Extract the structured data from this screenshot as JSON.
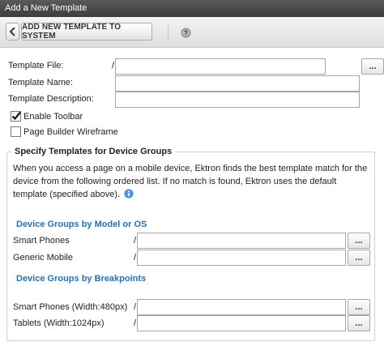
{
  "window": {
    "title": "Add a New Template"
  },
  "toolbar": {
    "add_label": "ADD NEW TEMPLATE TO SYSTEM",
    "back_icon": "back-arrow-icon",
    "help_icon": "help-icon"
  },
  "form": {
    "template_file": {
      "label": "Template File:",
      "prefix": "/",
      "value": "",
      "browse_label": "..."
    },
    "template_name": {
      "label": "Template Name:",
      "value": ""
    },
    "template_description": {
      "label": "Template Description:",
      "value": ""
    },
    "enable_toolbar": {
      "label": "Enable Toolbar",
      "checked": true
    },
    "page_builder_wireframe": {
      "label": "Page Builder Wireframe",
      "checked": false
    }
  },
  "device_groups": {
    "legend": "Specify Templates for Device Groups",
    "description": "When you access a page on a mobile device, Ektron finds the best template match for the device from the following ordered list. If no match is found, Ektron uses the default template (specified above).",
    "info_icon": "info-icon",
    "by_model": {
      "heading": "Device Groups by Model or OS",
      "rows": [
        {
          "label": "Smart Phones",
          "prefix": "/",
          "value": "",
          "browse_label": "..."
        },
        {
          "label": "Generic Mobile",
          "prefix": "/",
          "value": "",
          "browse_label": "..."
        }
      ]
    },
    "by_breakpoints": {
      "heading": "Device Groups by Breakpoints",
      "rows": [
        {
          "label": "Smart Phones (Width:480px)",
          "prefix": "/",
          "value": "",
          "browse_label": "..."
        },
        {
          "label": "Tablets (Width:1024px)",
          "prefix": "/",
          "value": "",
          "browse_label": "..."
        }
      ]
    }
  },
  "colors": {
    "titlebar": "#3c3c3c",
    "section_heading": "#2b6fa8",
    "info_icon": "#3a7fd0"
  }
}
